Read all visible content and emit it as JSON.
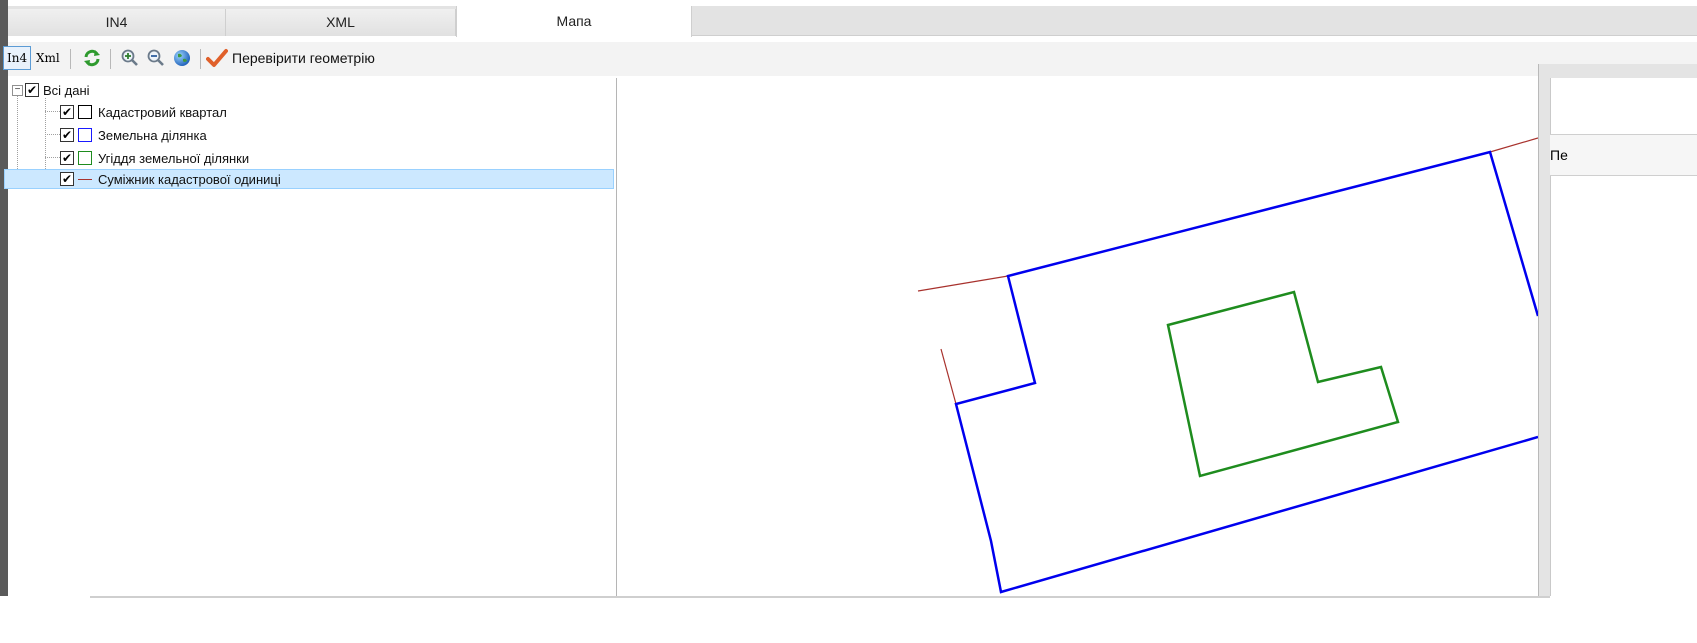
{
  "tabs": [
    {
      "label": "IN4",
      "active": false
    },
    {
      "label": "XML",
      "active": false
    },
    {
      "label": "Мапа",
      "active": true
    }
  ],
  "toolbar": {
    "in4_label": "In4",
    "xml_label": "Xml",
    "check_geometry_label": "Перевірити геометрію"
  },
  "tree": {
    "root_label": "Всі дані",
    "root_checked": true,
    "layers": [
      {
        "label": "Кадастровий квартал",
        "checked": true,
        "legend": "square",
        "color": "#000000"
      },
      {
        "label": "Земельна ділянка",
        "checked": true,
        "legend": "square",
        "color": "#1a1aff"
      },
      {
        "label": "Угіддя земельної ділянки",
        "checked": true,
        "legend": "square",
        "color": "#1e8c1e"
      },
      {
        "label": "Суміжник кадастрової одиниці",
        "checked": true,
        "legend": "line",
        "color": "#a8322d",
        "selected": true
      }
    ]
  },
  "right_panel": {
    "header_text": "Пе"
  },
  "colors": {
    "parcel": "#0000ee",
    "land_use": "#1e8c1e",
    "neighbor": "#a8322d",
    "selection": "#cce8ff"
  }
}
